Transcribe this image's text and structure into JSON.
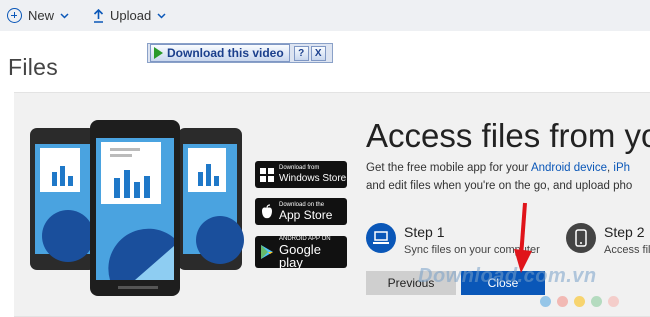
{
  "toolbar": {
    "new_label": "New",
    "upload_label": "Upload"
  },
  "page": {
    "title": "Files"
  },
  "banner": {
    "headline": "Access files from yo",
    "subtext_prefix": "Get the free mobile app for your ",
    "link_android": "Android device",
    "subtext_sep": ", ",
    "link_iphone": "iPh",
    "subtext_line2": "and edit files when you're on the go, and upload pho",
    "stores": {
      "windows_small": "Download from",
      "windows_big": "Windows Store",
      "appstore_small": "Download on the",
      "appstore_big": "App Store",
      "google_small": "ANDROID APP ON",
      "google_big": "Google play"
    },
    "step1": {
      "title": "Step 1",
      "desc": "Sync files on your computer"
    },
    "step2": {
      "title": "Step 2",
      "desc": "Access fil"
    },
    "previous_label": "Previous",
    "close_label": "Close"
  },
  "download_bar": {
    "label": "Download this video",
    "help": "?",
    "close": "X"
  },
  "watermark": {
    "text": "Download.com.vn"
  },
  "colors": {
    "accent": "#0a57b8",
    "toolbar_bg": "#eef0f3",
    "banner_bg": "#f1f1f1",
    "arrow": "#e0141a"
  }
}
